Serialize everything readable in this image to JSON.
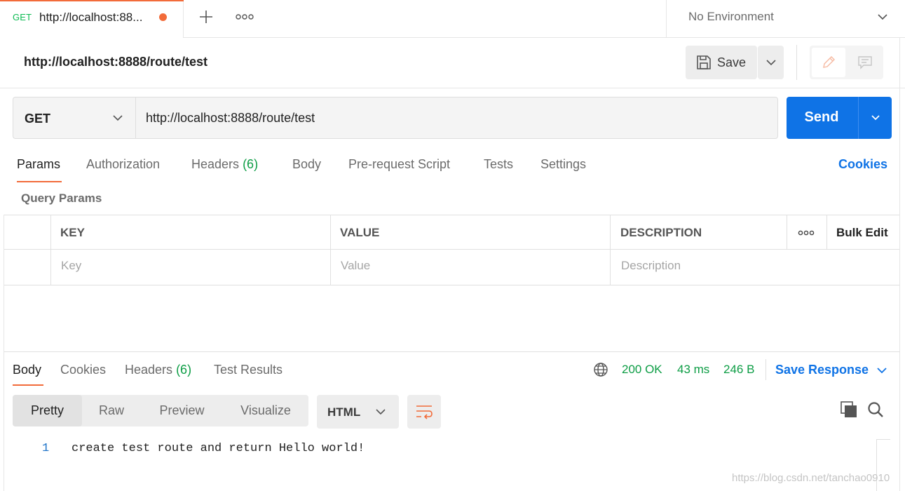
{
  "tab": {
    "method": "GET",
    "url": "http://localhost:88...",
    "unsaved_indicator": "orange-dot",
    "new_tab_icon": "plus-icon",
    "more_icon": "more-horizontal-icon"
  },
  "environment": {
    "label": "No Environment",
    "icon": "chevron-down-icon"
  },
  "request": {
    "title": "http://localhost:8888/route/test",
    "save_label": "Save",
    "save_icon": "save-icon",
    "edit_icon": "pencil-icon",
    "comment_icon": "comment-icon"
  },
  "url_bar": {
    "method": "GET",
    "url": "http://localhost:8888/route/test",
    "send_label": "Send"
  },
  "request_tabs": [
    {
      "label": "Params",
      "count": "",
      "active": true
    },
    {
      "label": "Authorization",
      "count": "",
      "active": false
    },
    {
      "label": "Headers",
      "count": "(6)",
      "active": false
    },
    {
      "label": "Body",
      "count": "",
      "active": false
    },
    {
      "label": "Pre-request Script",
      "count": "",
      "active": false
    },
    {
      "label": "Tests",
      "count": "",
      "active": false
    },
    {
      "label": "Settings",
      "count": "",
      "active": false
    }
  ],
  "cookies_link": "Cookies",
  "query_params": {
    "label": "Query Params",
    "columns": [
      "KEY",
      "VALUE",
      "DESCRIPTION"
    ],
    "placeholders": [
      "Key",
      "Value",
      "Description"
    ],
    "bulk_edit_label": "Bulk Edit"
  },
  "response": {
    "tabs": [
      {
        "label": "Body",
        "count": "",
        "active": true
      },
      {
        "label": "Cookies",
        "count": "",
        "active": false
      },
      {
        "label": "Headers",
        "count": "(6)",
        "active": false
      },
      {
        "label": "Test Results",
        "count": "",
        "active": false
      }
    ],
    "status": "200 OK",
    "time": "43 ms",
    "size": "246 B",
    "save_response_label": "Save Response",
    "view_modes": [
      "Pretty",
      "Raw",
      "Preview",
      "Visualize"
    ],
    "active_view": "Pretty",
    "format": "HTML",
    "body_lines": [
      {
        "number": "1",
        "text": "create test route and return Hello world!"
      }
    ]
  },
  "colors": {
    "accent_orange": "#f26b3a",
    "primary_blue": "#0f73e6",
    "success_green": "#0d9d45"
  },
  "watermark": "https://blog.csdn.net/tanchao0910"
}
